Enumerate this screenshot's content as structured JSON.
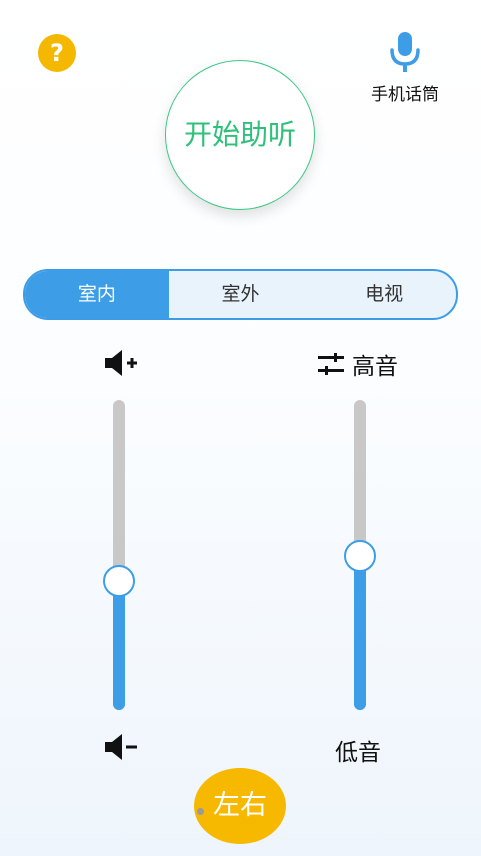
{
  "help": {
    "label": "?"
  },
  "mic": {
    "label": "手机话筒",
    "icon": "microphone-icon"
  },
  "start_button": {
    "label": "开始助听"
  },
  "modes": {
    "tabs": [
      {
        "label": "室内",
        "active": true
      },
      {
        "label": "室外",
        "active": false
      },
      {
        "label": "电视",
        "active": false
      }
    ]
  },
  "volume": {
    "up_icon": "volume-up-icon",
    "down_icon": "volume-down-icon",
    "level": 0.42
  },
  "tone": {
    "treble_label": "高音",
    "bass_label": "低音",
    "eq_icon": "equalizer-icon",
    "level": 0.5
  },
  "lr_button": {
    "label": "左右"
  },
  "colors": {
    "accent": "#3d9de6",
    "start_green": "#2fc07a",
    "help_yellow": "#f5b800",
    "track_gray": "#c8c8c8"
  }
}
